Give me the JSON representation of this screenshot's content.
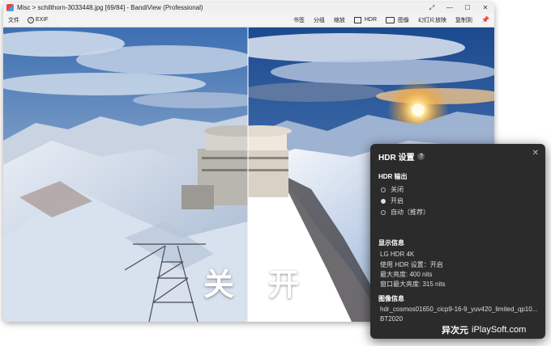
{
  "window": {
    "title": "Misc > schilthorn-3033448.jpg [69/84] - BandiView (Professional)",
    "controls": [
      "⤢",
      "—",
      "☐",
      "✕"
    ]
  },
  "menubar": {
    "file": "文件",
    "exif": "EXIF",
    "right_items": [
      "书签",
      "分组",
      "缩放",
      "HDR",
      "图像",
      "幻灯片放映",
      "复制到"
    ]
  },
  "overlay_labels": {
    "left": "关",
    "right": "开"
  },
  "hdr_panel": {
    "title": "HDR 设置",
    "help": "?",
    "close": "✕",
    "output_heading": "HDR 输出",
    "options": [
      "关闭",
      "开启",
      "自动（推荐）"
    ],
    "selected_option": 1,
    "display_heading": "显示信息",
    "display_lines": [
      "LG HDR 4K",
      "使用 HDR 设置：开启",
      "最大亮度: 400 nits",
      "窗口最大亮度: 315 nits"
    ],
    "image_heading": "图像信息",
    "image_lines": [
      "hdr_cosmos01650_cicp9-16-9_yuv420_limited_qp10...",
      "BT2020"
    ]
  },
  "watermark": {
    "cn": "异次元",
    "en": "iPlaySoft.com"
  },
  "colors": {
    "panel_bg": "#2b2b2b",
    "titlebar_bg": "#f0f0f0"
  }
}
